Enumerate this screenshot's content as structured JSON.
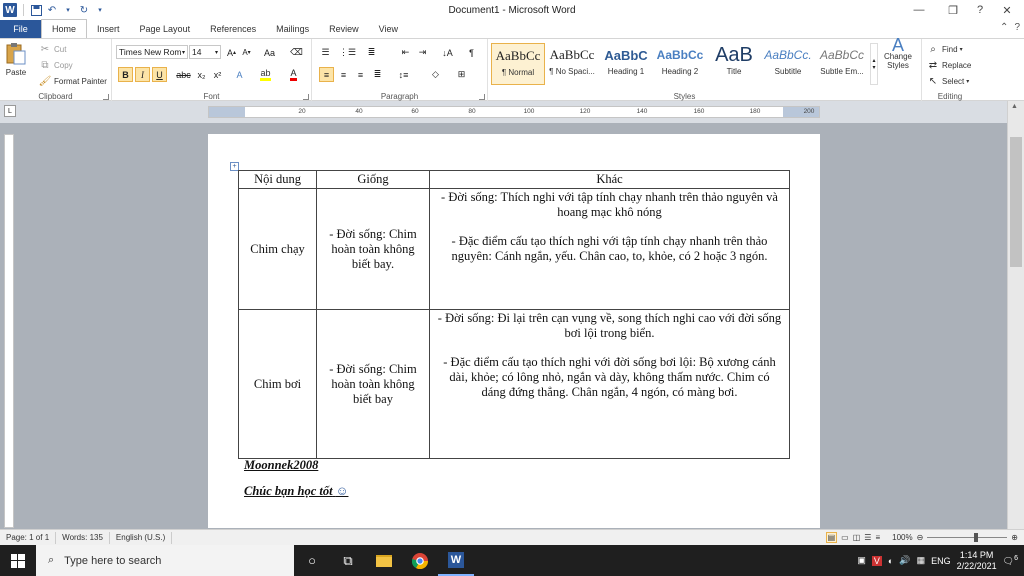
{
  "window": {
    "title": "Document1 - Microsoft Word"
  },
  "tabs": [
    "File",
    "Home",
    "Insert",
    "Page Layout",
    "References",
    "Mailings",
    "Review",
    "View"
  ],
  "clipboard": {
    "paste": "Paste",
    "cut": "Cut",
    "copy": "Copy",
    "format_painter": "Format Painter",
    "label": "Clipboard"
  },
  "font": {
    "family": "Times New Rom",
    "size": "14",
    "label": "Font",
    "bold": "B",
    "italic": "I",
    "underline": "U"
  },
  "paragraph": {
    "label": "Paragraph"
  },
  "styles": {
    "label": "Styles",
    "items": [
      {
        "sample": "AaBbCc",
        "name": "¶ Normal"
      },
      {
        "sample": "AaBbCc",
        "name": "¶ No Spaci..."
      },
      {
        "sample": "AaBbC",
        "name": "Heading 1"
      },
      {
        "sample": "AaBbCc",
        "name": "Heading 2"
      },
      {
        "sample": "AaB",
        "name": "Title"
      },
      {
        "sample": "AaBbCc.",
        "name": "Subtitle"
      },
      {
        "sample": "AaBbCc",
        "name": "Subtle Em..."
      }
    ],
    "change_styles": "Change Styles"
  },
  "editing": {
    "find": "Find",
    "replace": "Replace",
    "select": "Select",
    "label": "Editing"
  },
  "ruler": {
    "ticks": [
      "20",
      "40",
      "60",
      "80",
      "100",
      "120",
      "140",
      "160",
      "180",
      "200"
    ]
  },
  "table": {
    "headers": [
      "Nội dung",
      "Giống",
      "Khác"
    ],
    "rows": [
      {
        "name": "Chim chạy",
        "same": "- Đời sống: Chim hoàn toàn không biết bay.",
        "diff": [
          "- Đời sống: Thích nghi với tập tính chạy nhanh trên thảo nguyên và hoang mạc khô nóng",
          "- Đặc điểm cấu tạo thích nghi với tập tính chạy nhanh trên thảo nguyên: Cánh ngắn, yếu. Chân cao, to, khỏe, có 2 hoặc 3 ngón."
        ]
      },
      {
        "name": "Chim bơi",
        "same": "- Đời sống: Chim hoàn toàn không biết bay",
        "diff": [
          "- Đời sống: Đi lại trên cạn vụng về, song thích nghi cao với đời sống bơi lội trong biển.",
          "- Đặc điểm cấu tạo thích nghi với đời sống bơi lội: Bộ xương cánh dài, khỏe; có lông nhỏ, ngắn và dày, không thấm nước. Chim có dáng đứng thẳng. Chân ngắn, 4 ngón, có màng bơi."
        ]
      }
    ]
  },
  "signature": {
    "author": "Moonnek2008",
    "wish": "Chúc bạn học tốt",
    "emoji": "☺"
  },
  "status": {
    "page": "Page: 1 of 1",
    "words": "Words: 135",
    "language": "English (U.S.)",
    "zoom": "100%"
  },
  "taskbar": {
    "search_placeholder": "Type here to search",
    "time": "1:14 PM",
    "date": "2/22/2021",
    "lang": "ENG",
    "notifications": "6"
  },
  "colors": {
    "accent": "#2b579a",
    "file_tab": "#2b579a",
    "style_selected": "#fdf1d2"
  }
}
